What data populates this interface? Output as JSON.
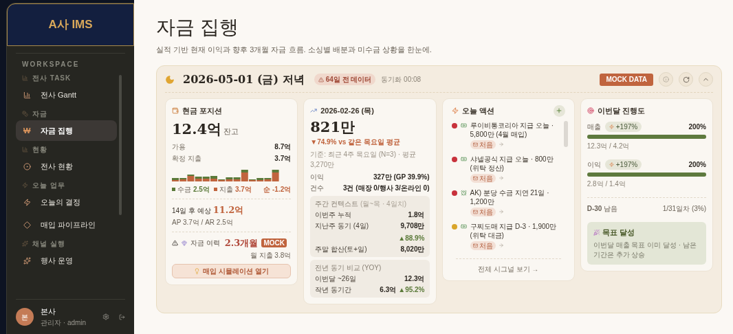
{
  "sidebar": {
    "logo": "A사 IMS",
    "workspace_label": "WORKSPACE",
    "sections": [
      {
        "header": "전사 TASK",
        "items": [
          {
            "label": "전사 Gantt",
            "selected": false
          }
        ]
      },
      {
        "header": "자금",
        "items": [
          {
            "label": "자금 집행",
            "selected": true,
            "glyph": "₩"
          }
        ]
      },
      {
        "header": "현황",
        "items": [
          {
            "label": "전사 현황",
            "selected": false
          }
        ]
      },
      {
        "header": "오늘 업무",
        "items": [
          {
            "label": "오늘의 결정",
            "selected": false
          },
          {
            "label": "매입 파이프라인",
            "selected": false
          }
        ]
      },
      {
        "header": "채널 실행",
        "items": [
          {
            "label": "행사 운영",
            "selected": false
          }
        ]
      }
    ],
    "user": {
      "avatar": "본",
      "name": "본사",
      "role": "관리자 · admin"
    }
  },
  "page": {
    "title": "자금 집행",
    "subtitle": "실적 기반 현재 이익과 향후 3개월 자금 흐름. 소싱별 배분과 미수금 상황을 한눈에."
  },
  "panel": {
    "date": "2026-05-01 (금) 저녁",
    "stale_badge": "64일 전 데이터",
    "sync": "동기화 00:08",
    "mock_button": "MOCK DATA"
  },
  "cash": {
    "title": "현금 포지션",
    "amount": "12.4억",
    "amount_suffix": "잔고",
    "rows": [
      {
        "label": "가용",
        "value": "8.7억"
      },
      {
        "label": "확정 지출",
        "value": "3.7억"
      }
    ],
    "legend_in": "수금",
    "legend_in_value": "2.5억",
    "legend_out": "지출",
    "legend_out_value": "3.7억",
    "net": "순 -1.2억",
    "forecast_label": "14일 후 예상",
    "forecast_value": "11.2억",
    "forecast_detail": "AP 3.7억 / AR 2.5억",
    "runway_label": "자금 여력",
    "runway_value": "2.3개월",
    "runway_badge": "MOCK",
    "runway_note": "월 지출 3.8억",
    "button": "매입 시뮬레이션 열기"
  },
  "daily": {
    "date": "2026-02-26 (목)",
    "amount": "821만",
    "change": "▼74.9% vs 같은 목요일 평균",
    "basis": "기준: 최근 4주 목요일 (N=3) · 평균 3,270만",
    "rows": [
      {
        "label": "이익",
        "value": "327만 (GP 39.9%)"
      },
      {
        "label": "건수",
        "value": "3건 (매장 0/행사 3/온라인 0)"
      }
    ],
    "weekly": {
      "title": "주간 컨텍스트",
      "note": "(월~목 · 4일치)",
      "rows": [
        {
          "label": "이번주 누적",
          "value": "1.8억"
        },
        {
          "label": "지난주 동기 (4일)",
          "value": "9,708만",
          "delta": "▲88.9%"
        },
        {
          "label": "주말 합산(토+일)",
          "value": "8,020만"
        }
      ]
    },
    "yoy": {
      "title": "전년 동기 비교 (YOY)",
      "rows": [
        {
          "label": "이번달 ~26일",
          "value": "12.3억"
        },
        {
          "label": "작년 동기간",
          "value": "6.3억",
          "delta": "▲95.2%"
        }
      ]
    }
  },
  "actions": {
    "title": "오늘 액션",
    "items": [
      {
        "color": "#c8323c",
        "text": "루이비통코리아 지급 오늘 · 5,800만 (4월 매입)",
        "tag": "처음"
      },
      {
        "color": "#c8323c",
        "text": "샤넬공식 지급 오늘 · 800만 (위탁 정산)",
        "tag": "처음"
      },
      {
        "color": "#c8323c",
        "text": "AK) 분당 수금 지연 21일 · 1,200만",
        "tag": "처음"
      },
      {
        "color": "#d9a52b",
        "text": "구찌도매 지급 D-3 · 1,900만 (위탁 대금)",
        "tag": "처음"
      }
    ],
    "footer": "전체 시그널 보기 →"
  },
  "progress": {
    "title": "이번달 진행도",
    "metrics": [
      {
        "label": "매출",
        "badge": "+197%",
        "percent": "200%",
        "level": 1,
        "detail": "12.3억 / 4.2억"
      },
      {
        "label": "이익",
        "badge": "+197%",
        "percent": "200%",
        "level": 1,
        "detail": "2.8억 / 1.4억"
      }
    ],
    "remaining": "**D-30** 남음",
    "day": "1/31일차 (3%)",
    "goal_title": "목표 달성",
    "goal_text": "이번달 매출 목표 이미 달성 · 남은 기간은 추가 상승"
  }
}
